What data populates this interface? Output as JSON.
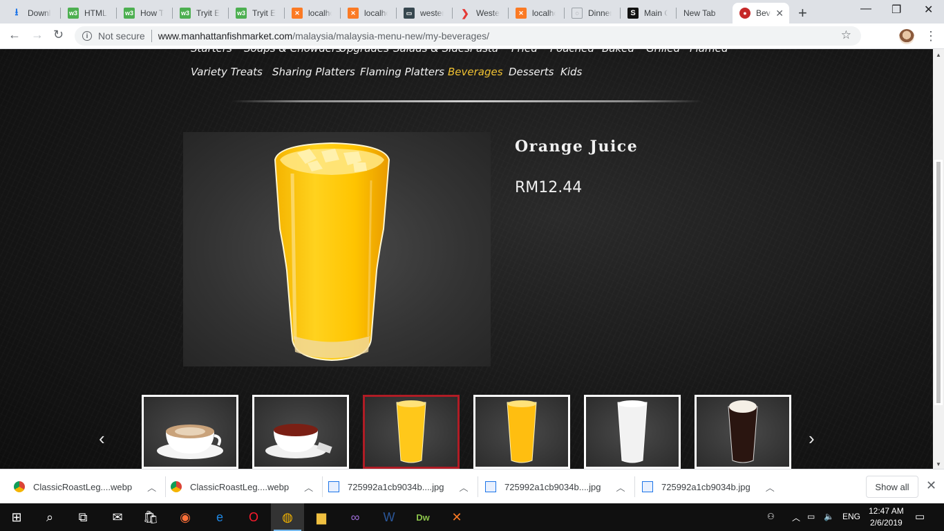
{
  "browser": {
    "tabs": [
      {
        "title": "Downlo",
        "icon": "download-icon"
      },
      {
        "title": "HTML R",
        "icon": "w3schools-icon"
      },
      {
        "title": "How To",
        "icon": "w3schools-icon"
      },
      {
        "title": "Tryit Ed",
        "icon": "w3schools-icon"
      },
      {
        "title": "Tryit Ed",
        "icon": "w3schools-icon"
      },
      {
        "title": "localhos",
        "icon": "xampp-icon"
      },
      {
        "title": "localhos",
        "icon": "xampp-icon"
      },
      {
        "title": "western",
        "icon": "site-icon"
      },
      {
        "title": "Western",
        "icon": "play-icon"
      },
      {
        "title": "localhos",
        "icon": "xampp-icon"
      },
      {
        "title": "Dinner",
        "icon": "page-icon"
      },
      {
        "title": "Main Co",
        "icon": "s-icon"
      },
      {
        "title": "New Tab",
        "icon": ""
      },
      {
        "title": "Beve",
        "icon": "fishmarket-icon"
      }
    ],
    "security_label": "Not secure",
    "url_host": "www.manhattanfishmarket.com",
    "url_path": "/malaysia/malaysia-menu-new/my-beverages/"
  },
  "page": {
    "categories_row1": [
      "Starters",
      "Soups & Chowders",
      "Upgrades",
      "Salads & Sides",
      "Pasta",
      "Fried",
      "Poached",
      "Baked",
      "Grilled",
      "Flamed"
    ],
    "categories_row2": [
      "Variety Treats",
      "Sharing Platters",
      "Flaming Platters",
      "Beverages",
      "Desserts",
      "Kids"
    ],
    "active_category": "Beverages",
    "product": {
      "name": "Orange Juice",
      "price": "RM12.44"
    },
    "thumbnails": [
      "cappuccino",
      "tea",
      "orange-juice",
      "orange-juice",
      "milk-drink",
      "cola-float"
    ],
    "selected_thumbnail": 2
  },
  "downloads": [
    {
      "name": "ClassicRoastLeg....webp",
      "icon": "chrome-icon"
    },
    {
      "name": "ClassicRoastLeg....webp",
      "icon": "chrome-icon"
    },
    {
      "name": "725992a1cb9034b....jpg",
      "icon": "image-file-icon"
    },
    {
      "name": "725992a1cb9034b....jpg",
      "icon": "image-file-icon"
    },
    {
      "name": "725992a1cb9034b.jpg",
      "icon": "image-file-icon"
    }
  ],
  "show_all_label": "Show all",
  "taskbar": {
    "language": "ENG",
    "time": "12:47 AM",
    "date": "2/6/2019"
  },
  "colors": {
    "active_category": "#f1c232",
    "selected_thumb_border": "#b01c25"
  }
}
